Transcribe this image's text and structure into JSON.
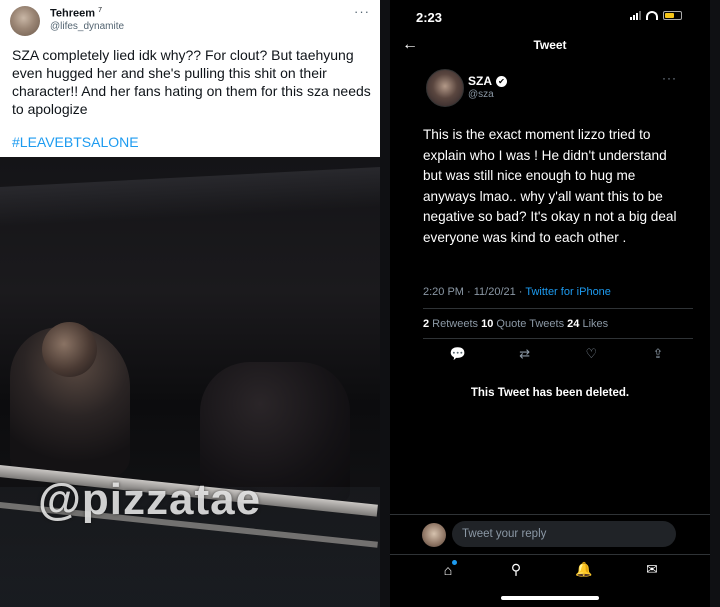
{
  "left_tweet": {
    "name": "Tehreem",
    "name_suffix": "7",
    "handle": "@lifes_dynamite",
    "more_icon": "···",
    "text": "SZA completely lied idk why?? For clout? But taehyung even hugged her and she's pulling this shit on their character!! And her fans hating on them for this sza needs to apologize",
    "hashtag": "#LEAVEBTSALONE",
    "video_watermark": "@pizzatae"
  },
  "phone": {
    "status_time": "2:23",
    "header_title": "Tweet",
    "back_icon": "←",
    "tweet": {
      "name": "SZA",
      "verified_icon": "✔",
      "handle": "@sza",
      "more_icon": "···",
      "text": "This is the exact moment lizzo tried to explain who I was ! He didn't understand but was still nice enough to hug me anyways lmao.. why y'all want this to be negative so bad? It's okay n not a big deal everyone was kind to each other .",
      "timestamp": "2:20 PM · 11/20/21 · ",
      "source": "Twitter for iPhone",
      "retweets_count": "2",
      "retweets_label": " Retweets ",
      "quotes_count": "10",
      "quotes_label": " Quote Tweets ",
      "likes_count": "24",
      "likes_label": " Likes"
    },
    "actions": {
      "reply": "💬",
      "retweet": "⇄",
      "like": "♡",
      "share": "⇪"
    },
    "deleted_notice": "This Tweet has been deleted.",
    "reply_placeholder": "Tweet your reply",
    "tabs": {
      "home": "⌂",
      "search": "⚲",
      "notifications": "🔔",
      "messages": "✉"
    },
    "colors": {
      "accent": "#1d9bf0",
      "background": "#000000",
      "battery": "#f5c518"
    }
  }
}
